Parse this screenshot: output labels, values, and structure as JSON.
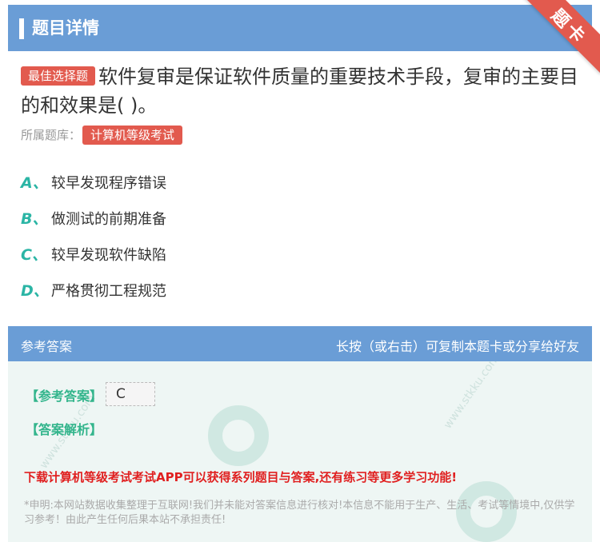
{
  "header": {
    "title": "题目详情",
    "corner_label": "题卡"
  },
  "question": {
    "badge": "最佳选择题",
    "text": "软件复审是保证软件质量的重要技术手段，复审的主要目的和效果是( )。",
    "source_label": "所属题库：",
    "source_value": "计算机等级考试"
  },
  "options": [
    {
      "letter": "A、",
      "text": "较早发现程序错误"
    },
    {
      "letter": "B、",
      "text": "做测试的前期准备"
    },
    {
      "letter": "C、",
      "text": "较早发现软件缺陷"
    },
    {
      "letter": "D、",
      "text": "严格贯彻工程规范"
    }
  ],
  "answer_section": {
    "title": "参考答案",
    "hint": "长按（或右击）可复制本题卡或分享给好友",
    "answer_label": "【参考答案】",
    "answer_value": "C",
    "analysis_label": "【答案解析】",
    "download_text": "下载计算机等级考试考试APP可以获得系列题目与答案,还有练习等更多学习功能!",
    "disclaimer": "*申明:本网站数据收集整理于互联网!我们并未能对答案信息进行核对!本信息不能用于生产、生活、考试等情境中,仅供学习参考！由此产生任何后果本站不承担责任!",
    "watermark": "www.stkku.com"
  },
  "colors": {
    "header_blue": "#6a9dd6",
    "badge_red": "#e25a4e",
    "option_teal": "#2bb5a5",
    "answer_green": "#33b58c",
    "download_red": "#e02020"
  }
}
